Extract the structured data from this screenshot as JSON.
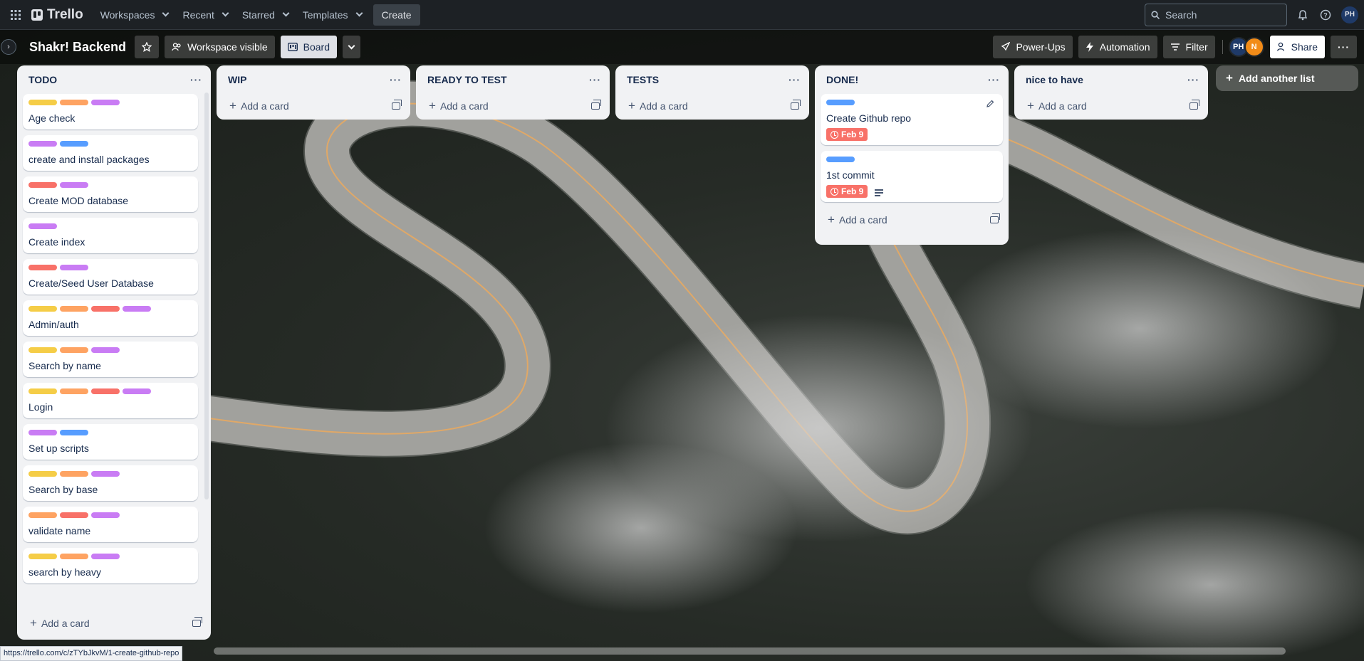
{
  "topnav": {
    "brand": "Trello",
    "menus": [
      "Workspaces",
      "Recent",
      "Starred",
      "Templates"
    ],
    "create_label": "Create",
    "search_placeholder": "Search",
    "user_initials": "PH"
  },
  "board": {
    "title": "Shakr! Backend",
    "visibility_label": "Workspace visible",
    "view_label": "Board",
    "powerups_label": "Power-Ups",
    "automation_label": "Automation",
    "filter_label": "Filter",
    "members": [
      {
        "initials": "PH",
        "color": "#1f3a68"
      },
      {
        "initials": "N",
        "color": "#f28c18"
      }
    ],
    "share_label": "Share",
    "add_list_label": "Add another list"
  },
  "colors": {
    "yellow": "#f5cd47",
    "orange": "#fea362",
    "red": "#f87168",
    "purple": "#c97cf4",
    "blue": "#579dff"
  },
  "add_card_label": "Add a card",
  "lists": [
    {
      "title": "TODO",
      "cards": [
        {
          "title": "Age check",
          "labels": [
            "yellow",
            "orange",
            "purple"
          ]
        },
        {
          "title": "create and install packages",
          "labels": [
            "purple",
            "blue"
          ]
        },
        {
          "title": "Create MOD database",
          "labels": [
            "red",
            "purple"
          ]
        },
        {
          "title": "Create index",
          "labels": [
            "purple"
          ]
        },
        {
          "title": "Create/Seed User Database",
          "labels": [
            "red",
            "purple"
          ]
        },
        {
          "title": "Admin/auth",
          "labels": [
            "yellow",
            "orange",
            "red",
            "purple"
          ]
        },
        {
          "title": "Search by name",
          "labels": [
            "yellow",
            "orange",
            "purple"
          ]
        },
        {
          "title": "Login",
          "labels": [
            "yellow",
            "orange",
            "red",
            "purple"
          ]
        },
        {
          "title": "Set up scripts",
          "labels": [
            "purple",
            "blue"
          ]
        },
        {
          "title": "Search by base",
          "labels": [
            "yellow",
            "orange",
            "purple"
          ]
        },
        {
          "title": "validate name",
          "labels": [
            "orange",
            "red",
            "purple"
          ]
        },
        {
          "title": "search by heavy",
          "labels": [
            "yellow",
            "orange",
            "purple"
          ]
        }
      ]
    },
    {
      "title": "WIP",
      "cards": []
    },
    {
      "title": "READY TO TEST",
      "cards": []
    },
    {
      "title": "TESTS",
      "cards": []
    },
    {
      "title": "DONE!",
      "cards": [
        {
          "title": "Create Github repo",
          "labels": [
            "blue"
          ],
          "due": "Feb 9"
        },
        {
          "title": "1st commit",
          "labels": [
            "blue"
          ],
          "due": "Feb 9"
        }
      ]
    },
    {
      "title": "nice to have",
      "cards": []
    }
  ],
  "status_url": "https://trello.com/c/zTYbJkvM/1-create-github-repo"
}
